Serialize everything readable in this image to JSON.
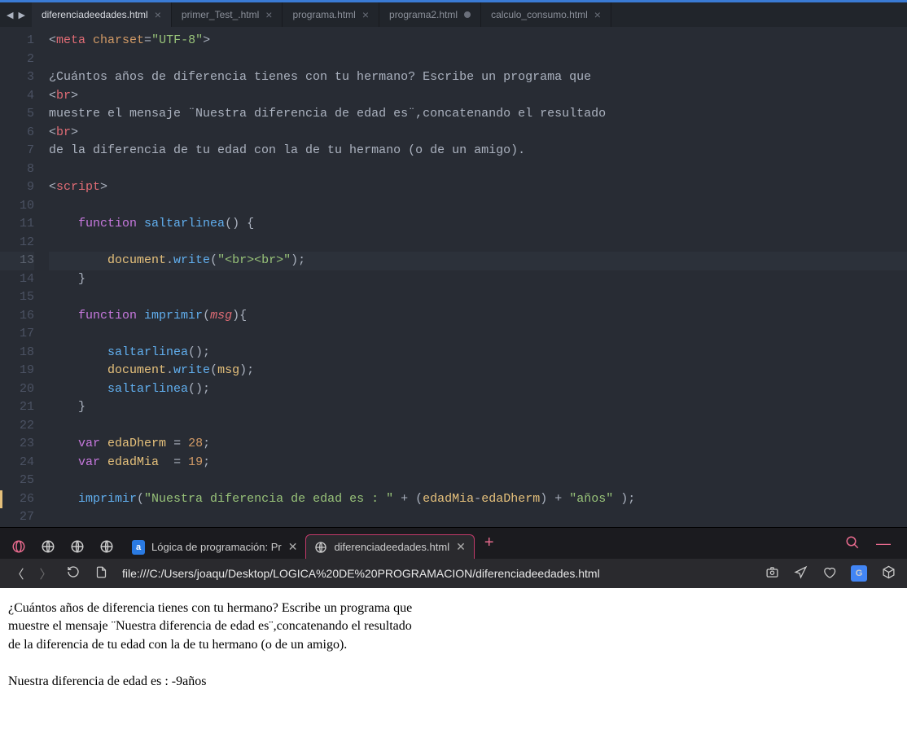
{
  "editor": {
    "tabs": [
      {
        "label": "diferenciadeedades.html",
        "active": true,
        "dirty": false
      },
      {
        "label": "primer_Test_.html",
        "active": false,
        "dirty": false
      },
      {
        "label": "programa.html",
        "active": false,
        "dirty": false
      },
      {
        "label": "programa2.html",
        "active": false,
        "dirty": true
      },
      {
        "label": "calculo_consumo.html",
        "active": false,
        "dirty": false
      }
    ],
    "highlight_line": 13,
    "code_lines": [
      {
        "n": 1,
        "tokens": [
          [
            "t-ang",
            "<"
          ],
          [
            "t-tag",
            "meta "
          ],
          [
            "t-attr",
            "charset"
          ],
          [
            "t-punc",
            "="
          ],
          [
            "t-str",
            "\"UTF-8\""
          ],
          [
            "t-ang",
            ">"
          ]
        ]
      },
      {
        "n": 2,
        "tokens": []
      },
      {
        "n": 3,
        "tokens": [
          [
            "t-txt",
            "¿Cuántos años de diferencia tienes con tu hermano? Escribe un programa que"
          ]
        ]
      },
      {
        "n": 4,
        "tokens": [
          [
            "t-ang",
            "<"
          ],
          [
            "t-tag",
            "br"
          ],
          [
            "t-ang",
            ">"
          ]
        ]
      },
      {
        "n": 5,
        "tokens": [
          [
            "t-txt",
            "muestre el mensaje ¨Nuestra diferencia de edad es¨,concatenando el resultado"
          ]
        ]
      },
      {
        "n": 6,
        "tokens": [
          [
            "t-ang",
            "<"
          ],
          [
            "t-tag",
            "br"
          ],
          [
            "t-ang",
            ">"
          ]
        ]
      },
      {
        "n": 7,
        "tokens": [
          [
            "t-txt",
            "de la diferencia de tu edad con la de tu hermano (o de un amigo)."
          ]
        ]
      },
      {
        "n": 8,
        "tokens": []
      },
      {
        "n": 9,
        "tokens": [
          [
            "t-ang",
            "<"
          ],
          [
            "t-tag",
            "script"
          ],
          [
            "t-ang",
            ">"
          ]
        ]
      },
      {
        "n": 10,
        "tokens": []
      },
      {
        "n": 11,
        "tokens": [
          [
            "t-txt",
            "    "
          ],
          [
            "t-kw",
            "function"
          ],
          [
            "t-txt",
            " "
          ],
          [
            "t-fn",
            "saltarlinea"
          ],
          [
            "t-punc",
            "() {"
          ]
        ]
      },
      {
        "n": 12,
        "tokens": []
      },
      {
        "n": 13,
        "tokens": [
          [
            "t-txt",
            "        "
          ],
          [
            "t-id",
            "document"
          ],
          [
            "t-punc",
            "."
          ],
          [
            "t-fn",
            "write"
          ],
          [
            "t-punc",
            "("
          ],
          [
            "t-str",
            "\"<br><br>\""
          ],
          [
            "t-punc",
            ");"
          ]
        ]
      },
      {
        "n": 14,
        "tokens": [
          [
            "t-txt",
            "    "
          ],
          [
            "t-punc",
            "}"
          ]
        ]
      },
      {
        "n": 15,
        "tokens": []
      },
      {
        "n": 16,
        "tokens": [
          [
            "t-txt",
            "    "
          ],
          [
            "t-kw",
            "function"
          ],
          [
            "t-txt",
            " "
          ],
          [
            "t-fn",
            "imprimir"
          ],
          [
            "t-punc",
            "("
          ],
          [
            "t-param",
            "msg"
          ],
          [
            "t-punc",
            "){"
          ]
        ]
      },
      {
        "n": 17,
        "tokens": []
      },
      {
        "n": 18,
        "tokens": [
          [
            "t-txt",
            "        "
          ],
          [
            "t-fn",
            "saltarlinea"
          ],
          [
            "t-punc",
            "();"
          ]
        ]
      },
      {
        "n": 19,
        "tokens": [
          [
            "t-txt",
            "        "
          ],
          [
            "t-id",
            "document"
          ],
          [
            "t-punc",
            "."
          ],
          [
            "t-fn",
            "write"
          ],
          [
            "t-punc",
            "("
          ],
          [
            "t-id",
            "msg"
          ],
          [
            "t-punc",
            ");"
          ]
        ]
      },
      {
        "n": 20,
        "tokens": [
          [
            "t-txt",
            "        "
          ],
          [
            "t-fn",
            "saltarlinea"
          ],
          [
            "t-punc",
            "();"
          ]
        ]
      },
      {
        "n": 21,
        "tokens": [
          [
            "t-txt",
            "    "
          ],
          [
            "t-punc",
            "}"
          ]
        ]
      },
      {
        "n": 22,
        "tokens": []
      },
      {
        "n": 23,
        "tokens": [
          [
            "t-txt",
            "    "
          ],
          [
            "t-kw",
            "var"
          ],
          [
            "t-txt",
            " "
          ],
          [
            "t-id",
            "edaDherm"
          ],
          [
            "t-txt",
            " "
          ],
          [
            "t-punc",
            "="
          ],
          [
            "t-txt",
            " "
          ],
          [
            "t-num",
            "28"
          ],
          [
            "t-punc",
            ";"
          ]
        ]
      },
      {
        "n": 24,
        "tokens": [
          [
            "t-txt",
            "    "
          ],
          [
            "t-kw",
            "var"
          ],
          [
            "t-txt",
            " "
          ],
          [
            "t-id",
            "edadMia"
          ],
          [
            "t-txt",
            "  "
          ],
          [
            "t-punc",
            "="
          ],
          [
            "t-txt",
            " "
          ],
          [
            "t-num",
            "19"
          ],
          [
            "t-punc",
            ";"
          ]
        ]
      },
      {
        "n": 25,
        "tokens": []
      },
      {
        "n": 26,
        "tokens": [
          [
            "t-txt",
            "    "
          ],
          [
            "t-fn",
            "imprimir"
          ],
          [
            "t-punc",
            "("
          ],
          [
            "t-str",
            "\"Nuestra diferencia de edad es : \""
          ],
          [
            "t-txt",
            " "
          ],
          [
            "t-punc",
            "+"
          ],
          [
            "t-txt",
            " ("
          ],
          [
            "t-id",
            "edadMia"
          ],
          [
            "t-punc",
            "-"
          ],
          [
            "t-id",
            "edaDherm"
          ],
          [
            "t-punc",
            ")"
          ],
          [
            "t-txt",
            " "
          ],
          [
            "t-punc",
            "+"
          ],
          [
            "t-txt",
            " "
          ],
          [
            "t-str",
            "\"años\""
          ],
          [
            "t-txt",
            " "
          ],
          [
            "t-punc",
            ");"
          ]
        ]
      },
      {
        "n": 27,
        "tokens": []
      }
    ]
  },
  "browser": {
    "tabs": [
      {
        "label": "Lógica de programación: Pr",
        "favicon": "alura",
        "active": false
      },
      {
        "label": "diferenciadeedades.html",
        "favicon": "globe",
        "active": true
      }
    ],
    "url": "file:///C:/Users/joaqu/Desktop/LOGICA%20DE%20PROGRAMACION/diferenciadeedades.html",
    "page": {
      "line1": "¿Cuántos años de diferencia tienes con tu hermano? Escribe un programa que",
      "line2": "muestre el mensaje ¨Nuestra diferencia de edad es¨,concatenando el resultado",
      "line3": "de la diferencia de tu edad con la de tu hermano (o de un amigo).",
      "result": "Nuestra diferencia de edad es : -9años"
    }
  }
}
